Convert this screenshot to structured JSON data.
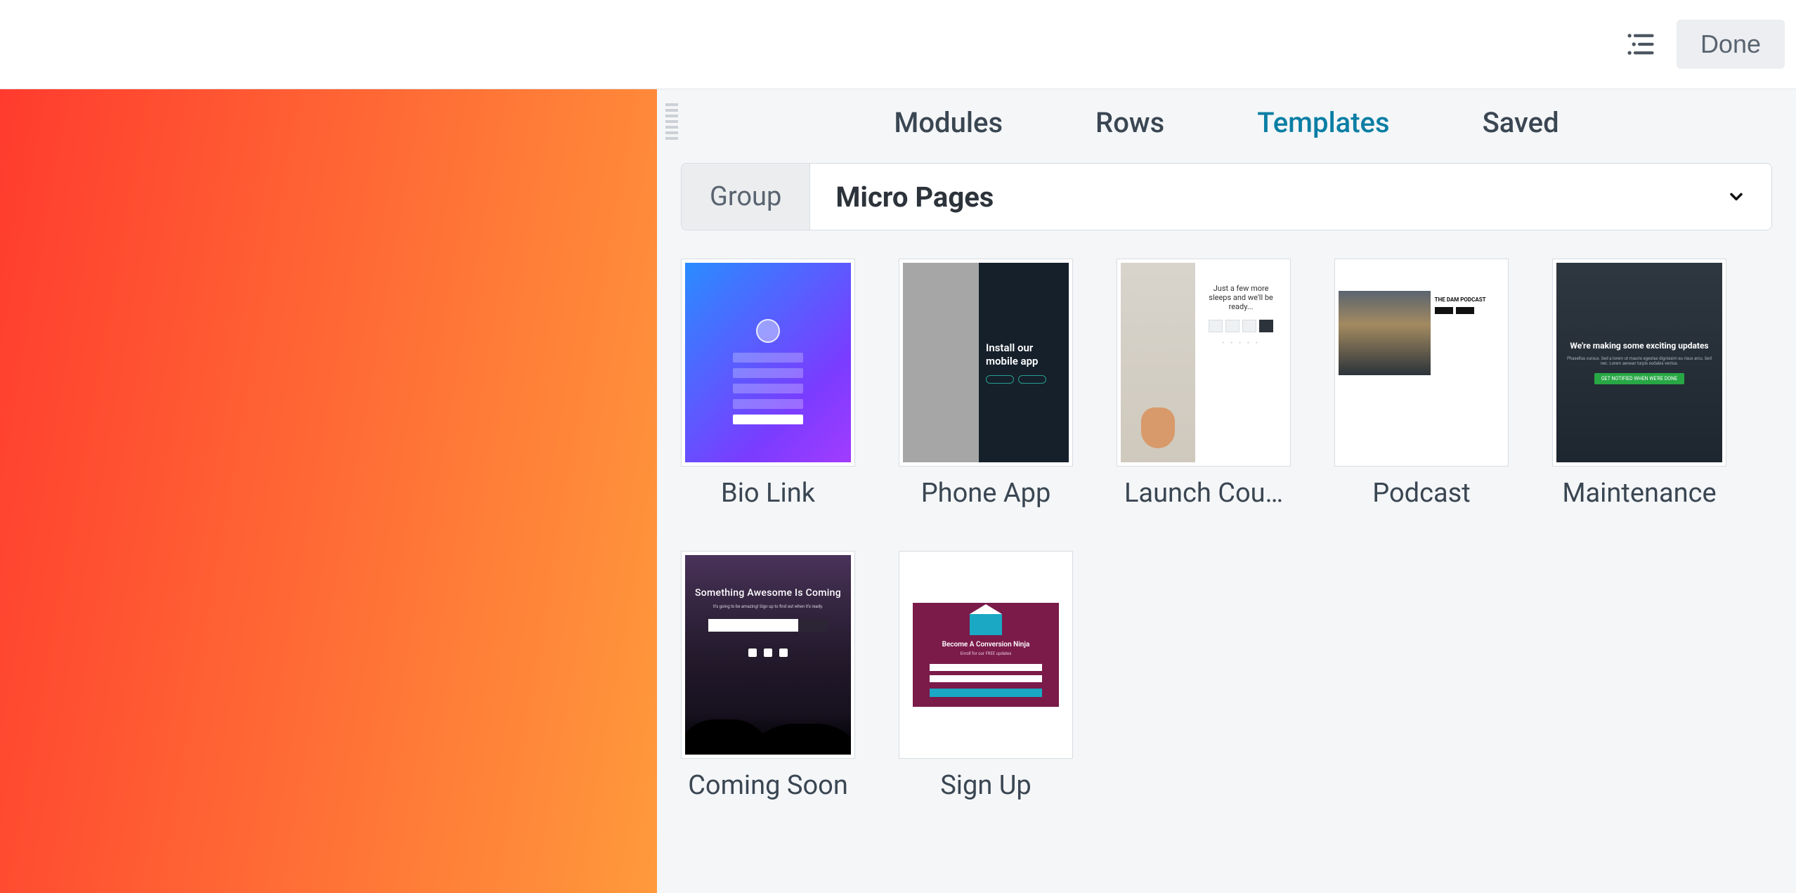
{
  "topbar": {
    "done": "Done"
  },
  "tabs": [
    "Modules",
    "Rows",
    "Templates",
    "Saved"
  ],
  "active_tab_index": 2,
  "group": {
    "label": "Group",
    "value": "Micro Pages"
  },
  "templates": {
    "biolink": {
      "title": "Bio Link"
    },
    "phoneapp": {
      "title": "Phone App",
      "thumb_headline": "Install our mobile app"
    },
    "launch": {
      "title": "Launch Cou…",
      "thumb_headline": "Just a few more sleeps and we'll be ready..."
    },
    "podcast": {
      "title": "Podcast",
      "thumb_headline": "THE DAM PODCAST"
    },
    "maint": {
      "title": "Maintenance",
      "thumb_headline": "We're making some exciting updates"
    },
    "coming": {
      "title": "Coming Soon",
      "thumb_headline": "Something Awesome Is Coming"
    },
    "signup": {
      "title": "Sign Up",
      "thumb_headline": "Become A Conversion Ninja"
    }
  }
}
